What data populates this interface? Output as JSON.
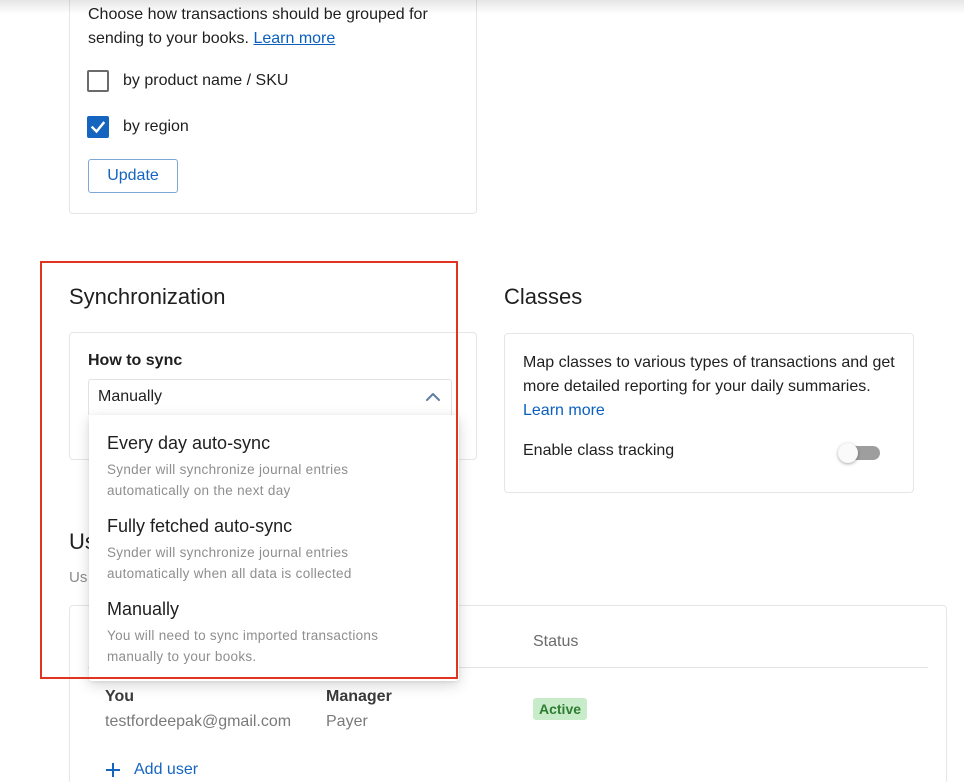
{
  "grouping": {
    "description": "Choose how transactions should be grouped for sending to your books.",
    "learn_more": "Learn more",
    "options": [
      {
        "label": "by product name / SKU",
        "checked": false
      },
      {
        "label": "by region",
        "checked": true
      }
    ],
    "update_label": "Update"
  },
  "sync": {
    "heading": "Synchronization",
    "how_label": "How to sync",
    "selected": "Manually",
    "dropdown_open": true,
    "options": [
      {
        "title": "Every day auto-sync",
        "description": "Synder will synchronize journal entries automatically on the next day"
      },
      {
        "title": "Fully fetched auto-sync",
        "description": "Synder will synchronize journal entries automatically when all data is collected"
      },
      {
        "title": "Manually",
        "description": "You will need to sync imported transactions manually to your books."
      }
    ]
  },
  "classes": {
    "heading": "Classes",
    "description": "Map classes to various types of transactions and get more detailed reporting for your daily summaries.",
    "learn_more": "Learn more",
    "enable_label": "Enable class tracking",
    "enabled": false
  },
  "users": {
    "heading_visible": "Us",
    "subtitle_visible": "Us",
    "columns": {
      "status": "Status"
    },
    "rows": [
      {
        "name": "You",
        "email": "testfordeepak@gmail.com",
        "role": "Manager",
        "role_sub": "Payer",
        "status": "Active"
      }
    ],
    "add_user_label": "Add user"
  },
  "colors": {
    "accent": "#1565c0",
    "link": "#0a5fbf",
    "highlight": "#e0341e",
    "badge_bg": "#c8ecc9",
    "badge_text": "#2e7d32"
  },
  "icons": {
    "checkbox_checked": "check-icon",
    "select_chevron": "chevron-up-icon",
    "add": "plus-icon"
  }
}
